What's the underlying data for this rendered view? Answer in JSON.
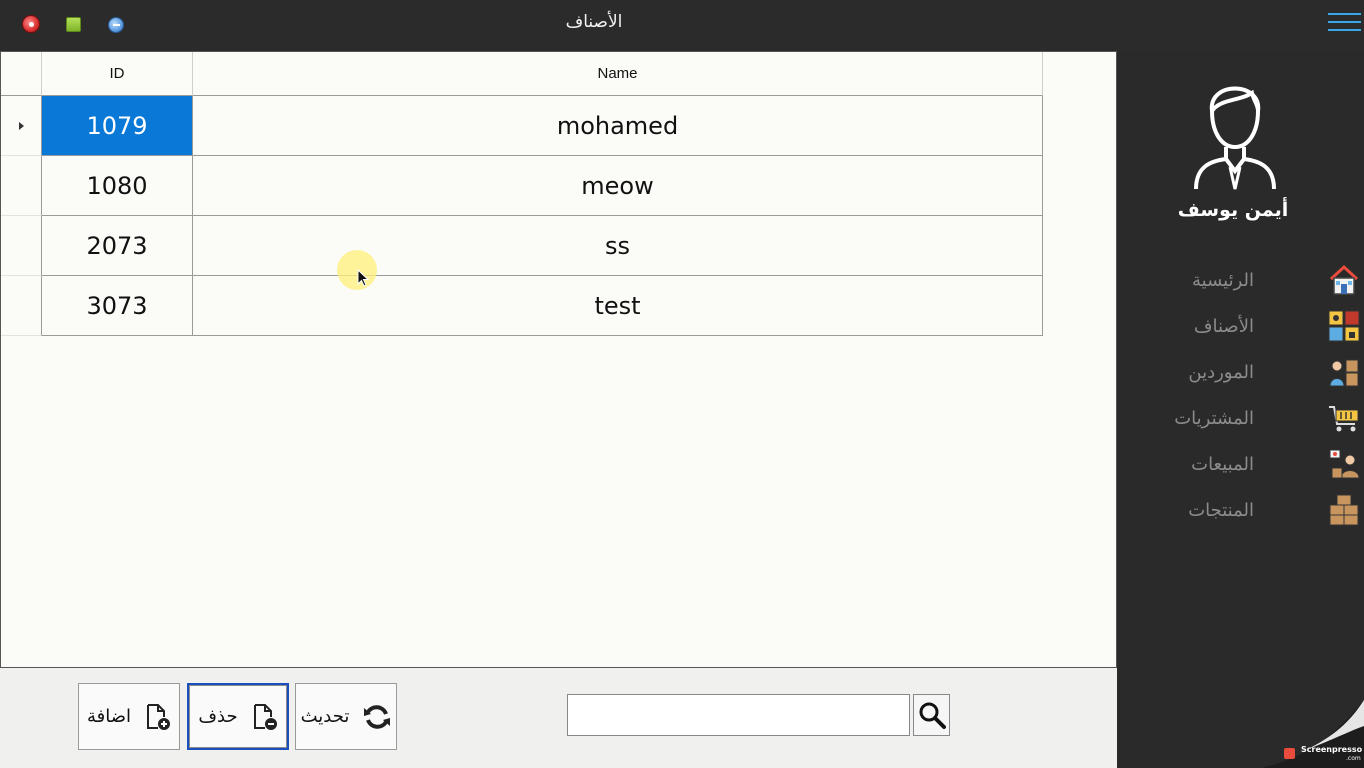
{
  "window": {
    "title": "الأصناف",
    "controls": [
      "close-icon",
      "maximize-icon",
      "minimize-icon"
    ]
  },
  "grid": {
    "columns": [
      "ID",
      "Name"
    ],
    "rows": [
      {
        "id": "1079",
        "name": "mohamed",
        "selected": true
      },
      {
        "id": "1080",
        "name": "meow",
        "selected": false
      },
      {
        "id": "2073",
        "name": "ss",
        "selected": false
      },
      {
        "id": "3073",
        "name": "test",
        "selected": false
      }
    ]
  },
  "toolbar": {
    "add_label": "اضافة",
    "delete_label": "حذف",
    "refresh_label": "تحديث",
    "search_value": "",
    "search_icon": "search-icon"
  },
  "sidebar": {
    "user_name": "أيمن يوسف",
    "menu_icon": "hamburger-icon",
    "items": [
      {
        "label": "الرئيسية",
        "icon": "home-icon"
      },
      {
        "label": "الأصناف",
        "icon": "categories-icon"
      },
      {
        "label": "الموردين",
        "icon": "suppliers-icon"
      },
      {
        "label": "المشتريات",
        "icon": "cart-icon"
      },
      {
        "label": "المبيعات",
        "icon": "sales-icon"
      },
      {
        "label": "المنتجات",
        "icon": "products-icon"
      }
    ]
  },
  "watermark": {
    "brand": "Screenpresso",
    "suffix": ".com"
  },
  "colors": {
    "selection": "#0a78d7",
    "titlebar": "#2b2b2b",
    "sidebar": "#2a2a2a",
    "accent": "#3aa6e8"
  }
}
